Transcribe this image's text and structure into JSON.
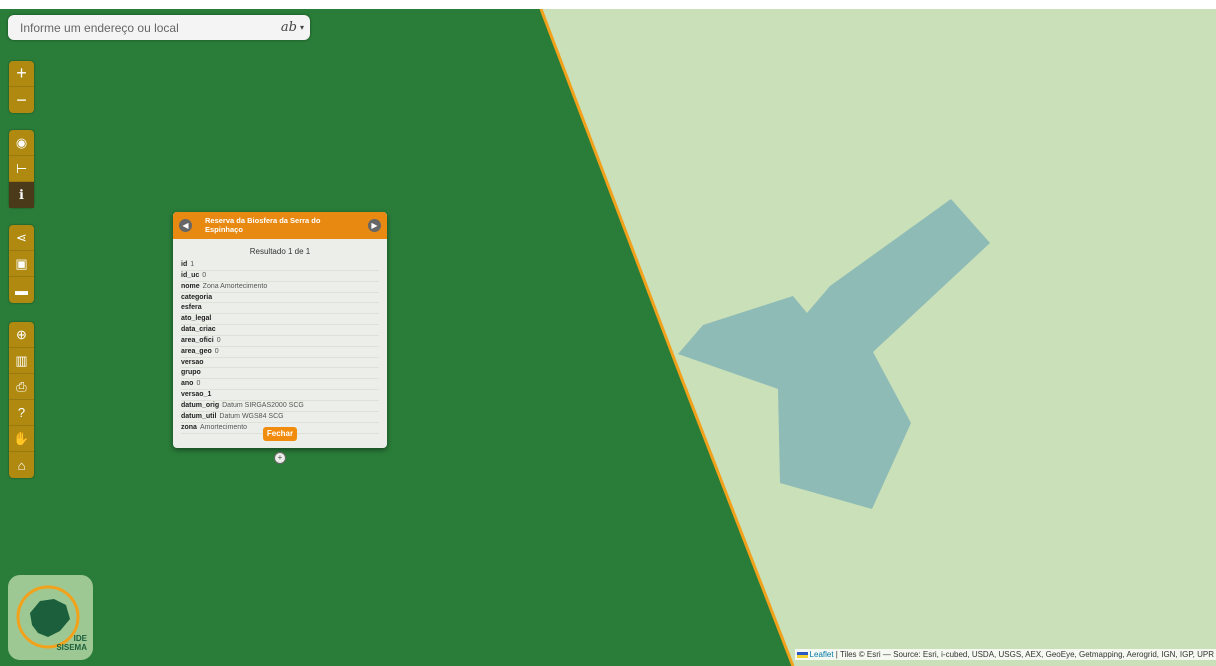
{
  "search": {
    "placeholder": "Informe um endereço ou local",
    "layer_label": "ab",
    "layer_caret": "▾"
  },
  "zoom": {
    "in_label": "+",
    "out_label": "−"
  },
  "toolbar": {
    "group2": [
      {
        "name": "globe-icon",
        "glyph": "◉"
      },
      {
        "name": "ruler-icon",
        "glyph": "⊢"
      },
      {
        "name": "info-icon",
        "glyph": "ℹ",
        "active": true
      }
    ],
    "group3": [
      {
        "name": "share-icon",
        "glyph": "⋖"
      },
      {
        "name": "save-icon",
        "glyph": "▣"
      },
      {
        "name": "folder-icon",
        "glyph": "▬"
      }
    ],
    "group4": [
      {
        "name": "crosshair-icon",
        "glyph": "⊕"
      },
      {
        "name": "map-icon",
        "glyph": "▥"
      },
      {
        "name": "print-icon",
        "glyph": "⎙"
      },
      {
        "name": "help-icon",
        "glyph": "?"
      },
      {
        "name": "hand-icon",
        "glyph": "✋"
      },
      {
        "name": "home-icon",
        "glyph": "⌂"
      }
    ]
  },
  "popup": {
    "title": "Reserva da Biosfera da Serra do Espinhaço",
    "result": "Resultado 1 de 1",
    "fields": [
      {
        "k": "id",
        "v": "1"
      },
      {
        "k": "id_uc",
        "v": "0"
      },
      {
        "k": "nome",
        "v": "Zona Amortecimento"
      },
      {
        "k": "categoria",
        "v": ""
      },
      {
        "k": "esfera",
        "v": ""
      },
      {
        "k": "ato_legal",
        "v": ""
      },
      {
        "k": "data_criac",
        "v": ""
      },
      {
        "k": "area_ofici",
        "v": "0"
      },
      {
        "k": "area_geo",
        "v": "0"
      },
      {
        "k": "versao",
        "v": ""
      },
      {
        "k": "grupo",
        "v": ""
      },
      {
        "k": "ano",
        "v": "0"
      },
      {
        "k": "versao_1",
        "v": ""
      },
      {
        "k": "datum_orig",
        "v": "Datum SIRGAS2000 SCG"
      },
      {
        "k": "datum_util",
        "v": "Datum WGS84 SCG"
      },
      {
        "k": "zona",
        "v": "Amortecimento"
      }
    ],
    "close_label": "Fechar"
  },
  "logo": {
    "line1": "IDE",
    "line2": "SISEMA"
  },
  "attribution": {
    "leaflet": "Leaflet",
    "text": " | Tiles © Esri — Source: Esri, i-cubed, USDA, USGS, AEX, GeoEye, Getmapping, Aerogrid, IGN, IGP, UPR"
  },
  "colors": {
    "reserve": "#2a7d39",
    "background": "#cae0b9",
    "border": "#f2a21a",
    "water": "#8ebbb5",
    "toolbar": "#b08a10",
    "popup_header": "#e88a12"
  }
}
